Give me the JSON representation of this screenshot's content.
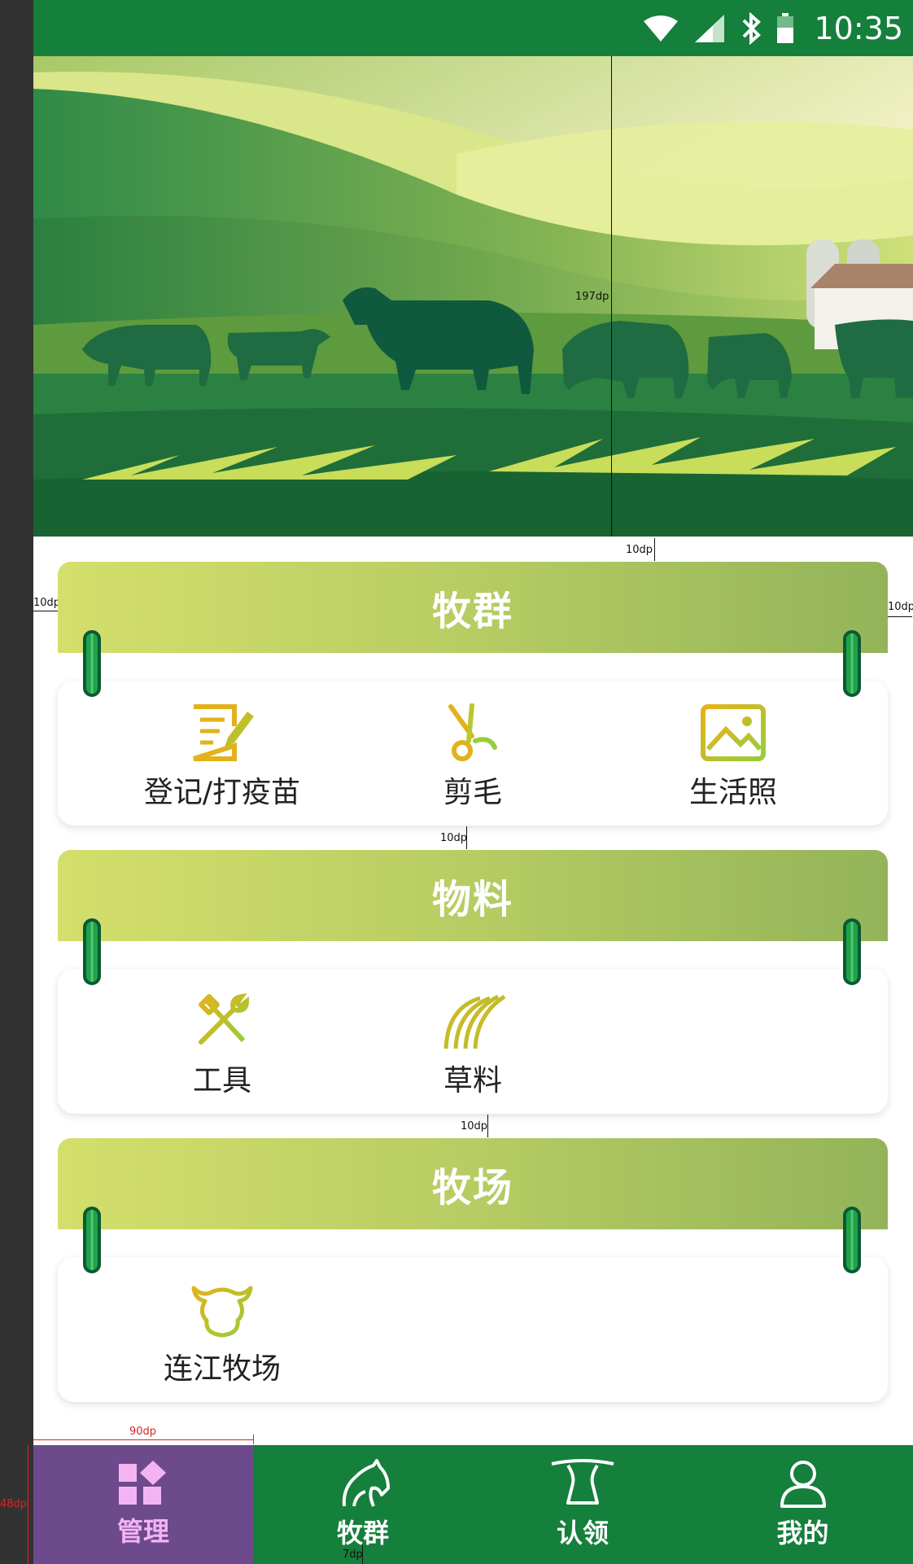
{
  "status_bar": {
    "time": "10:35"
  },
  "hero": {
    "dim_label": "197dp",
    "dim_label_below": "10dp"
  },
  "sections": [
    {
      "title": "牧群",
      "items": [
        "登记/打疫苗",
        "剪毛",
        "生活照"
      ]
    },
    {
      "title": "物料",
      "items": [
        "工具",
        "草料"
      ]
    },
    {
      "title": "牧场",
      "items": [
        "连江牧场"
      ]
    }
  ],
  "annotations": {
    "left_margin": "10dp",
    "right_margin": "10dp",
    "gap1": "10dp",
    "gap2": "10dp",
    "nav_width": "90dp",
    "nav_height": "48dp",
    "nav_top_pad": "7dp",
    "nav_bottom_pad": "7dp"
  },
  "nav": {
    "items": [
      "管理",
      "牧群",
      "认领",
      "我的"
    ],
    "active": "管理"
  },
  "colors": {
    "primary": "#157f3c",
    "active_nav": "#6d4a8c",
    "active_label": "#f4b4f4",
    "band_start": "#d4df6b",
    "band_end": "#93b459",
    "icon_gold": "#e2b21c",
    "icon_green": "#98cc3a"
  }
}
